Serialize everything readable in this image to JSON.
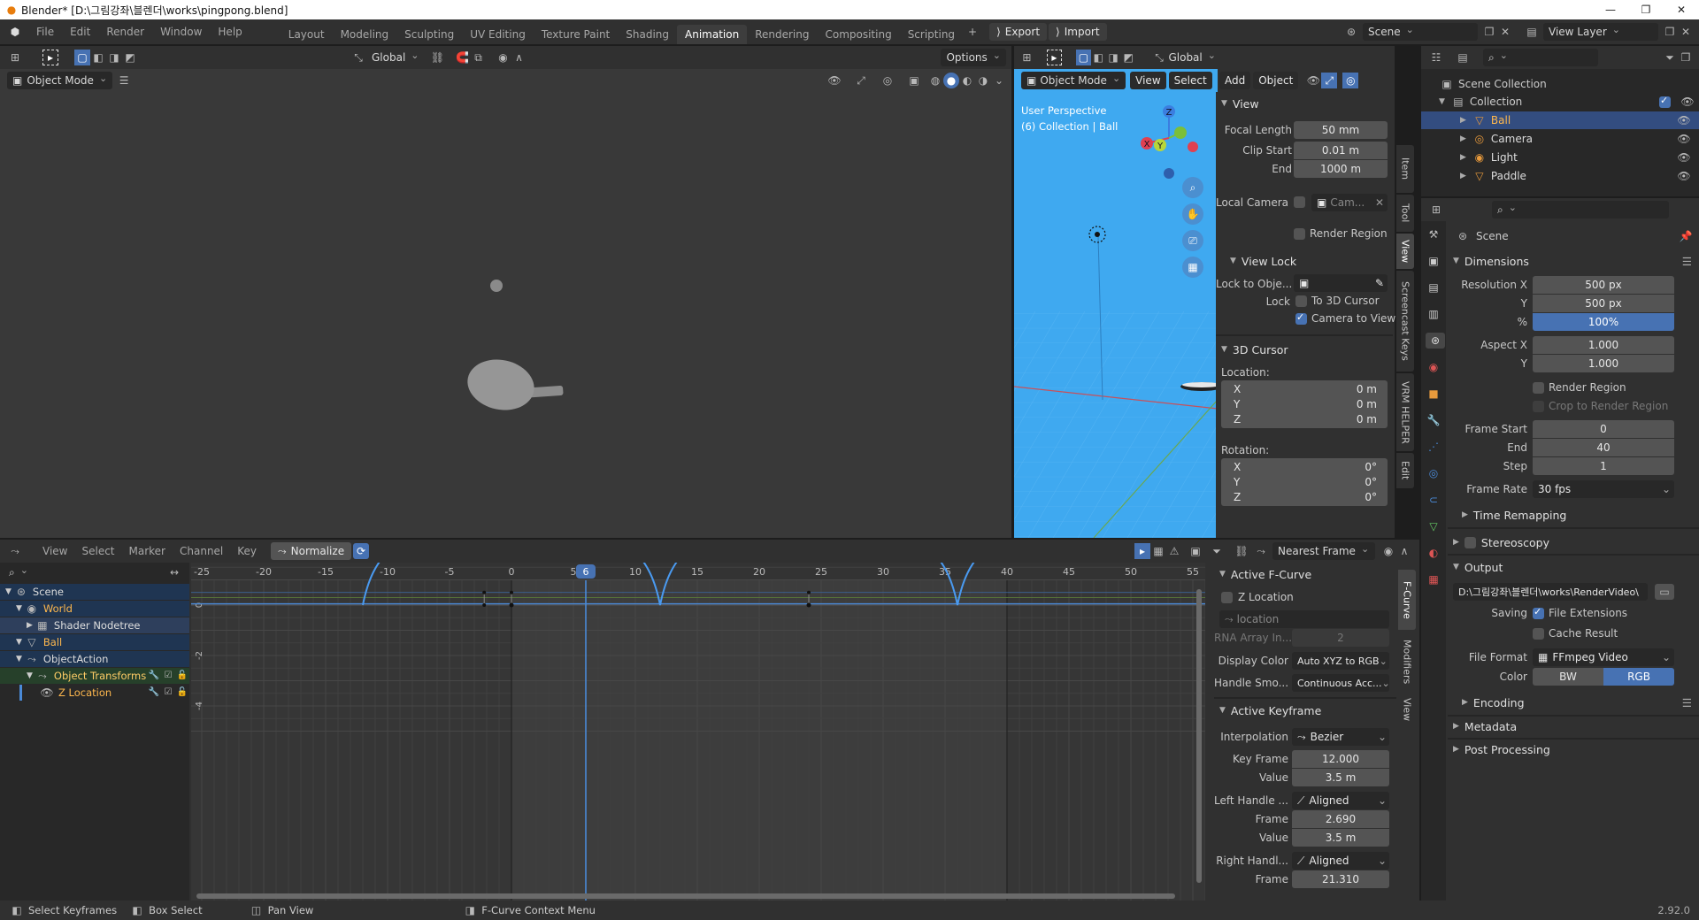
{
  "window": {
    "title": "Blender* [D:\\그림강좌\\블렌더\\works\\pingpong.blend]",
    "version": "2.92.0"
  },
  "menu": [
    "File",
    "Edit",
    "Render",
    "Window",
    "Help"
  ],
  "workspaces": [
    "Layout",
    "Modeling",
    "Sculpting",
    "UV Editing",
    "Texture Paint",
    "Shading",
    "Animation",
    "Rendering",
    "Compositing",
    "Scripting"
  ],
  "active_workspace": "Animation",
  "topbar": {
    "export": "Export",
    "import": "Import",
    "scene": "Scene",
    "view_layer": "View Layer"
  },
  "viewport_left": {
    "mode": "Object Mode",
    "transform": "Global",
    "options": "Options"
  },
  "viewport_right": {
    "mode": "Object Mode",
    "view": "View",
    "select": "Select",
    "add": "Add",
    "object": "Object",
    "transform": "Global",
    "overlay_line1": "User Perspective",
    "overlay_line2": "(6) Collection | Ball",
    "axis_z": "Z",
    "axis_y": "Y",
    "axis_x": "X"
  },
  "npanel": {
    "view_header": "View",
    "focal_label": "Focal Length",
    "focal_value": "50 mm",
    "clip_start_label": "Clip Start",
    "clip_start_value": "0.01 m",
    "end_label": "End",
    "end_value": "1000 m",
    "local_camera_label": "Local Camera",
    "local_camera_value": "Cam...",
    "render_region": "Render Region",
    "view_lock_header": "View Lock",
    "lock_obj_label": "Lock to Obje...",
    "lock_label": "Lock",
    "to_cursor": "To 3D Cursor",
    "camera_to_view": "Camera to View",
    "cursor_header": "3D Cursor",
    "location_label": "Location:",
    "rotation_label": "Rotation:",
    "loc": [
      {
        "a": "X",
        "v": "0 m"
      },
      {
        "a": "Y",
        "v": "0 m"
      },
      {
        "a": "Z",
        "v": "0 m"
      }
    ],
    "rot": [
      {
        "a": "X",
        "v": "0°"
      },
      {
        "a": "Y",
        "v": "0°"
      },
      {
        "a": "Z",
        "v": "0°"
      }
    ],
    "tabs": [
      "Item",
      "Tool",
      "View",
      "Screencast Keys",
      "VRM HELPER",
      "Edit"
    ],
    "active_tab": "View"
  },
  "outliner": {
    "scene_collection": "Scene Collection",
    "collection": "Collection",
    "items": [
      {
        "name": "Ball",
        "selected": true
      },
      {
        "name": "Camera",
        "selected": false
      },
      {
        "name": "Light",
        "selected": false
      },
      {
        "name": "Paddle",
        "selected": false
      }
    ]
  },
  "properties": {
    "context": "Scene",
    "dimensions_header": "Dimensions",
    "res_x_label": "Resolution X",
    "res_x": "500 px",
    "res_y_label": "Y",
    "res_y": "500 px",
    "pct_label": "%",
    "pct": "100%",
    "aspect_x_label": "Aspect X",
    "aspect_x": "1.000",
    "aspect_y_label": "Y",
    "aspect_y": "1.000",
    "render_region": "Render Region",
    "crop": "Crop to Render Region",
    "frame_start_label": "Frame Start",
    "frame_start": "0",
    "frame_end_label": "End",
    "frame_end": "40",
    "frame_step_label": "Step",
    "frame_step": "1",
    "frame_rate_label": "Frame Rate",
    "frame_rate": "30 fps",
    "time_remapping": "Time Remapping",
    "stereoscopy": "Stereoscopy",
    "output_header": "Output",
    "output_path": "D:\\그림강좌\\블렌더\\works\\RenderVideo\\",
    "saving_label": "Saving",
    "file_ext": "File Extensions",
    "cache": "Cache Result",
    "file_format_label": "File Format",
    "file_format": "FFmpeg Video",
    "color_label": "Color",
    "bw": "BW",
    "rgb": "RGB",
    "encoding": "Encoding",
    "metadata": "Metadata",
    "post_processing": "Post Processing"
  },
  "graph": {
    "menu": [
      "View",
      "Select",
      "Marker",
      "Channel",
      "Key"
    ],
    "normalize": "Normalize",
    "snap": "Nearest Frame",
    "current_frame": "6",
    "ruler": [
      "-25",
      "-20",
      "-15",
      "-10",
      "-5",
      "0",
      "5",
      "10",
      "15",
      "20",
      "25",
      "30",
      "35",
      "40",
      "45",
      "50",
      "55"
    ],
    "y_labels": [
      "4",
      "2",
      "0",
      "-2",
      "-4"
    ],
    "channels": [
      {
        "name": "Scene",
        "indent": 0
      },
      {
        "name": "World",
        "indent": 1
      },
      {
        "name": "Shader Nodetree",
        "indent": 2
      },
      {
        "name": "Ball",
        "indent": 1
      },
      {
        "name": "ObjectAction",
        "indent": 1
      },
      {
        "name": "Object Transforms",
        "indent": 2
      },
      {
        "name": "Z Location",
        "indent": 3
      }
    ],
    "tabs": [
      "F-Curve",
      "Modifiers",
      "View"
    ],
    "active_tab": "F-Curve"
  },
  "fcurve_panel": {
    "header": "Active F-Curve",
    "curve_name": "Z Location",
    "data_path": "location",
    "rna_label": "RNA Array In...",
    "rna_value": "2",
    "display_color_label": "Display Color",
    "display_color": "Auto XYZ to RGB",
    "handle_smooth_label": "Handle Smo...",
    "handle_smooth": "Continuous Acc...",
    "keyframe_header": "Active Keyframe",
    "interp_label": "Interpolation",
    "interp": "Bezier",
    "key_frame_label": "Key Frame",
    "key_frame": "12.000",
    "value_label": "Value",
    "value": "3.5 m",
    "left_handle_label": "Left Handle ...",
    "left_handle": "Aligned",
    "lh_frame_label": "Frame",
    "lh_frame": "2.690",
    "lh_value_label": "Value",
    "lh_value": "3.5 m",
    "right_handle_label": "Right Handl...",
    "right_handle": "Aligned",
    "rh_frame_label": "Frame",
    "rh_frame": "21.310"
  },
  "statusbar": {
    "select": "Select Keyframes",
    "box": "Box Select",
    "pan": "Pan View",
    "context": "F-Curve Context Menu"
  },
  "chart_data": {
    "type": "line",
    "series": [
      {
        "name": "Z Location",
        "x": [
          -12,
          0,
          12,
          24,
          36,
          48,
          60
        ],
        "y": [
          0,
          3.5,
          0,
          3.5,
          0,
          3.5,
          0
        ]
      }
    ],
    "xlim": [
      -25,
      56
    ],
    "ylim": [
      -4.3,
      4.3
    ]
  }
}
